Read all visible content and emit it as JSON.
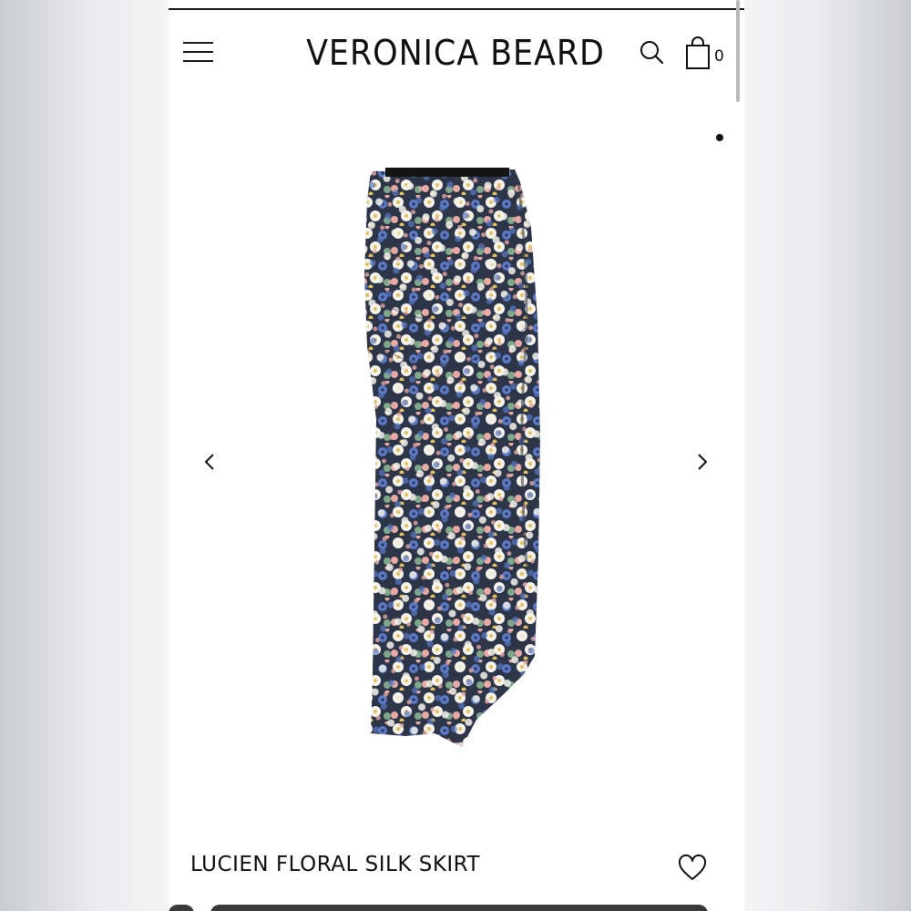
{
  "header": {
    "brand": "VERONICA BEARD",
    "menu_icon": "hamburger-menu-icon",
    "search_icon": "search-icon",
    "bag_icon": "shopping-bag-icon",
    "bag_count": "0"
  },
  "gallery": {
    "active_index": 1,
    "prev_icon": "chevron-left-icon",
    "next_icon": "chevron-right-icon",
    "image_alt": "floral print silk skirt"
  },
  "product": {
    "title": "LUCIEN FLORAL SILK SKIRT",
    "wishlist_icon": "heart-outline-icon"
  },
  "colors": {
    "ink": "#111111",
    "print_navy": "#2d3548",
    "print_blue": "#5a79c8",
    "print_pink": "#e8a9a3",
    "print_green": "#7fa88a",
    "print_yellow": "#e5c15a",
    "print_white": "#f4f2ea"
  }
}
